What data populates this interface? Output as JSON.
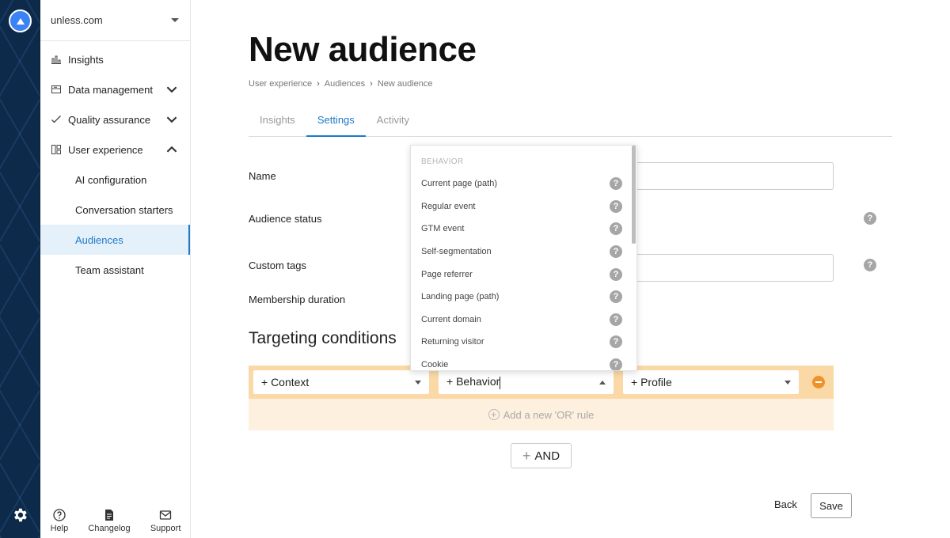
{
  "sidebar": {
    "org": "unless.com",
    "items": [
      {
        "label": "Insights"
      },
      {
        "label": "Data management"
      },
      {
        "label": "Quality assurance"
      },
      {
        "label": "User experience"
      }
    ],
    "sub_items": [
      {
        "label": "AI configuration"
      },
      {
        "label": "Conversation starters"
      },
      {
        "label": "Audiences"
      },
      {
        "label": "Team assistant"
      }
    ],
    "footer": {
      "help": "Help",
      "changelog": "Changelog",
      "support": "Support"
    }
  },
  "page": {
    "title": "New audience",
    "breadcrumb": [
      "User experience",
      "Audiences",
      "New audience"
    ],
    "tabs": [
      "Insights",
      "Settings",
      "Activity"
    ],
    "active_tab": "Settings"
  },
  "form": {
    "name_label": "Name",
    "status_label": "Audience status",
    "tags_label": "Custom tags",
    "duration_label": "Membership duration"
  },
  "targeting": {
    "heading": "Targeting conditions",
    "context": "+ Context",
    "behavior": "+ Behavior",
    "profile": "+ Profile",
    "add_or": "Add a new 'OR' rule",
    "and": "AND"
  },
  "dropdown": {
    "header": "BEHAVIOR",
    "options": [
      "Current page (path)",
      "Regular event",
      "GTM event",
      "Self-segmentation",
      "Page referrer",
      "Landing page (path)",
      "Current domain",
      "Returning visitor",
      "Cookie"
    ]
  },
  "actions": {
    "back": "Back",
    "save": "Save"
  },
  "colors": {
    "accent": "#1d7ac7",
    "rule_bg": "#fbd9a7",
    "remove": "#f0922c"
  }
}
